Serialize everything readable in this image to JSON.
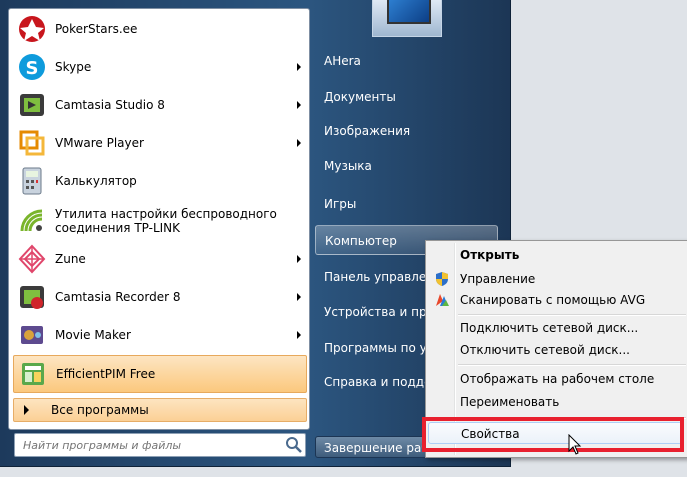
{
  "start_menu": {
    "programs": [
      {
        "label": "PokerStars.ee",
        "icon": "pokerstars-icon",
        "arrow": false
      },
      {
        "label": "Skype",
        "icon": "skype-icon",
        "arrow": true
      },
      {
        "label": "Camtasia Studio 8",
        "icon": "camtasia-studio-icon",
        "arrow": true
      },
      {
        "label": "VMware Player",
        "icon": "vmware-icon",
        "arrow": true
      },
      {
        "label": "Калькулятор",
        "icon": "calculator-icon",
        "arrow": false
      },
      {
        "label": "Утилита настройки беспроводного соединения TP-LINK",
        "icon": "wireless-icon",
        "arrow": false
      },
      {
        "label": "Zune",
        "icon": "zune-icon",
        "arrow": true
      },
      {
        "label": "Camtasia Recorder 8",
        "icon": "camtasia-recorder-icon",
        "arrow": true
      },
      {
        "label": "Movie Maker",
        "icon": "movie-maker-icon",
        "arrow": true
      },
      {
        "label": "EfficientPIM Free",
        "icon": "efficientpim-icon",
        "arrow": false,
        "selected": true
      }
    ],
    "all_programs": "Все программы",
    "search_placeholder": "Найти программы и файлы",
    "places": [
      {
        "label": "AHera"
      },
      {
        "label": "Документы"
      },
      {
        "label": "Изображения"
      },
      {
        "label": "Музыка"
      },
      {
        "label": "Игры"
      },
      {
        "label": "Компьютер",
        "hover": true
      },
      {
        "label": "Панель управления"
      },
      {
        "label": "Устройства и принтеры"
      },
      {
        "label": "Программы по умолчанию"
      },
      {
        "label": "Справка и поддержка"
      }
    ],
    "shutdown": "Завершение работы"
  },
  "context_menu": {
    "items": [
      {
        "label": "Открыть",
        "bold": true
      },
      {
        "label": "Управление",
        "icon": "shield-icon"
      },
      {
        "label": "Сканировать с помощью AVG",
        "icon": "avg-icon"
      },
      {
        "label": "Подключить сетевой диск..."
      },
      {
        "label": "Отключить сетевой диск..."
      },
      {
        "label": "Отображать на рабочем столе"
      },
      {
        "label": "Переименовать"
      },
      {
        "label": "Свойства",
        "highlighted": true
      }
    ]
  },
  "colors": {
    "highlight_frame": "#e8202e",
    "selected_program": "#fbc87d"
  }
}
